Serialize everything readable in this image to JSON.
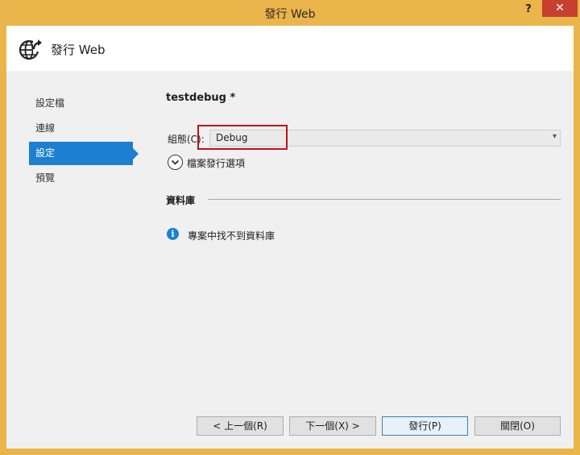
{
  "window": {
    "title": "發行 Web",
    "help_label": "?",
    "close_label": "✕"
  },
  "header": {
    "title": "發行 Web",
    "icon": "globe-publish-icon"
  },
  "sidebar": {
    "items": [
      {
        "label": "設定檔",
        "active": false
      },
      {
        "label": "連線",
        "active": false
      },
      {
        "label": "設定",
        "active": true
      },
      {
        "label": "預覽",
        "active": false
      }
    ]
  },
  "main": {
    "profile_title": "testdebug *",
    "configuration": {
      "label": "組態(C):",
      "value": "Debug"
    },
    "file_publish_options_label": "檔案發行選項",
    "database_section_title": "資料庫",
    "database_info": "專案中找不到資料庫"
  },
  "footer": {
    "prev_label": "< 上一個(R)",
    "next_label": "下一個(X) >",
    "publish_label": "發行(P)",
    "close_label": "關閉(O)"
  },
  "colors": {
    "window_frame": "#eab54a",
    "accent": "#1c7fd0",
    "highlight": "#c1121b",
    "close_button": "#c7402f"
  }
}
